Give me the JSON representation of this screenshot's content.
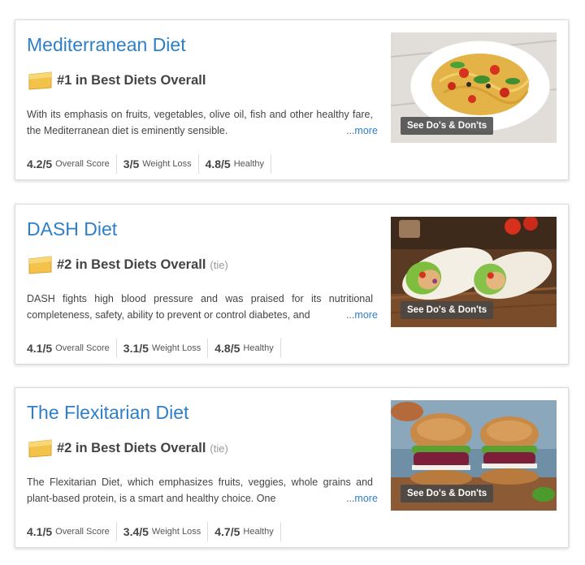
{
  "cards": [
    {
      "title": "Mediterranean Diet",
      "rank": "#1 in Best Diets Overall",
      "tie": "",
      "description": "With its emphasis on fruits, vegetables, olive oil, fish and other healthy fare, the Mediterranean diet is eminently sensible.",
      "more_dots": "...",
      "more_label": "more",
      "image_button": "See Do's & Don'ts",
      "image_subject": "pasta-dish",
      "scores": [
        {
          "value": "4.2/5",
          "label": "Overall Score"
        },
        {
          "value": "3/5",
          "label": "Weight Loss"
        },
        {
          "value": "4.8/5",
          "label": "Healthy"
        }
      ]
    },
    {
      "title": "DASH Diet",
      "rank": "#2 in Best Diets Overall",
      "tie": "(tie)",
      "description": "DASH fights high blood pressure and was praised for its nutritional completeness, safety, ability to prevent or control diabetes, and",
      "more_dots": "...",
      "more_label": "more",
      "image_button": "See Do's & Don'ts",
      "image_subject": "wraps",
      "scores": [
        {
          "value": "4.1/5",
          "label": "Overall Score"
        },
        {
          "value": "3.1/5",
          "label": "Weight Loss"
        },
        {
          "value": "4.8/5",
          "label": "Healthy"
        }
      ]
    },
    {
      "title": "The Flexitarian Diet",
      "rank": "#2 in Best Diets Overall",
      "tie": "(tie)",
      "description": "The Flexitarian Diet, which emphasizes fruits, veggies, whole grains and plant-based protein, is a smart and healthy choice. One",
      "more_dots": "...",
      "more_label": "more",
      "image_button": "See Do's & Don'ts",
      "image_subject": "veggie-burgers",
      "scores": [
        {
          "value": "4.1/5",
          "label": "Overall Score"
        },
        {
          "value": "3.4/5",
          "label": "Weight Loss"
        },
        {
          "value": "4.7/5",
          "label": "Healthy"
        }
      ]
    }
  ],
  "colors": {
    "link": "#2f7fc8",
    "rank_badge": "#f3c24a",
    "overlay_button": "#464646"
  }
}
